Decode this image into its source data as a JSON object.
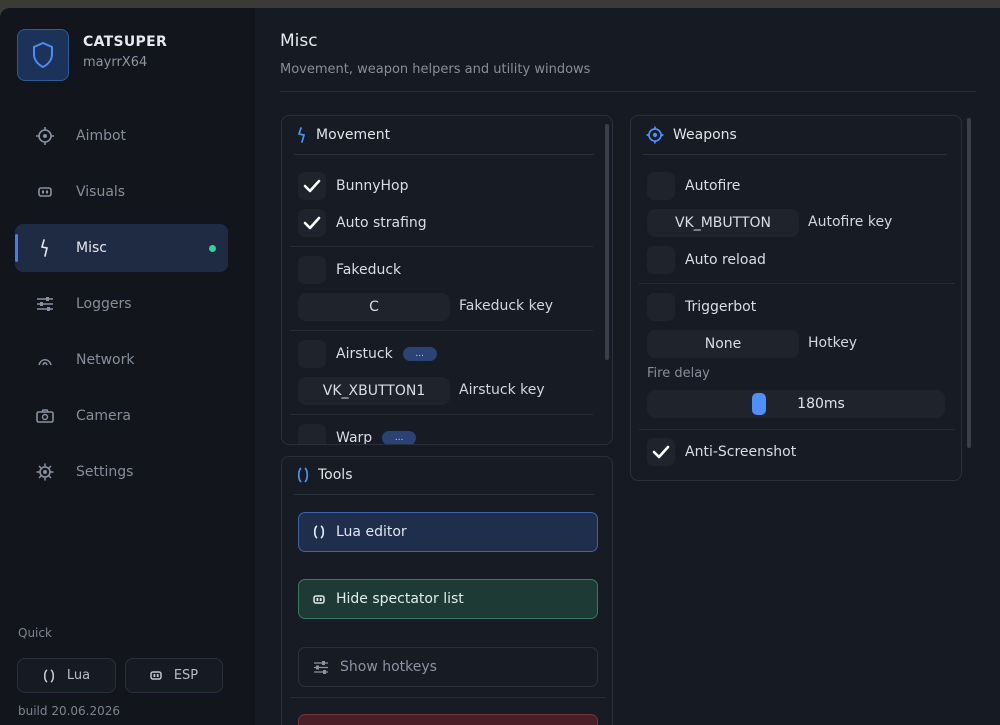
{
  "brand": {
    "name": "CATSUPER",
    "user": "mayrrX64"
  },
  "nav": [
    {
      "label": "Aimbot",
      "icon": "crosshair-icon"
    },
    {
      "label": "Visuals",
      "icon": "eye-icon"
    },
    {
      "label": "Misc",
      "icon": "lightning-icon",
      "active": true
    },
    {
      "label": "Loggers",
      "icon": "sliders-icon"
    },
    {
      "label": "Network",
      "icon": "wifi-icon"
    },
    {
      "label": "Camera",
      "icon": "camera-icon"
    },
    {
      "label": "Settings",
      "icon": "gear-icon"
    }
  ],
  "quick": {
    "label": "Quick",
    "lua": "Lua",
    "esp": "ESP"
  },
  "build": "build 20.06.2026",
  "page": {
    "title": "Misc",
    "subtitle": "Movement, weapon helpers and utility windows"
  },
  "movement": {
    "title": "Movement",
    "bunnyhop": {
      "label": "BunnyHop",
      "checked": true
    },
    "autostrafe": {
      "label": "Auto strafing",
      "checked": true
    },
    "fakeduck": {
      "label": "Fakeduck",
      "checked": false
    },
    "fakeduck_key": {
      "value": "C",
      "label": "Fakeduck key"
    },
    "airstuck": {
      "label": "Airstuck",
      "badge": "...",
      "checked": false
    },
    "airstuck_key": {
      "value": "VK_XBUTTON1",
      "label": "Airstuck key"
    },
    "warp": {
      "label": "Warp",
      "badge": "...",
      "checked": false
    }
  },
  "tools": {
    "title": "Tools",
    "lua_editor": "Lua editor",
    "hide_spectator": "Hide spectator list",
    "show_hotkeys": "Show hotkeys"
  },
  "weapons": {
    "title": "Weapons",
    "autofire": {
      "label": "Autofire",
      "checked": false
    },
    "autofire_key": {
      "value": "VK_MBUTTON",
      "label": "Autofire key"
    },
    "autoreload": {
      "label": "Auto reload",
      "checked": false
    },
    "triggerbot": {
      "label": "Triggerbot",
      "checked": false
    },
    "hotkey": {
      "value": "None",
      "label": "Hotkey"
    },
    "fire_delay": {
      "label": "Fire delay",
      "value_text": "180ms",
      "fraction": 0.37
    },
    "antiscreenshot": {
      "label": "Anti-Screenshot",
      "checked": true
    }
  },
  "colors": {
    "accent": "#3f7df0",
    "active_dot": "#33d29a",
    "window_bg": "#161a22",
    "sidebar_bg": "#12151c"
  }
}
